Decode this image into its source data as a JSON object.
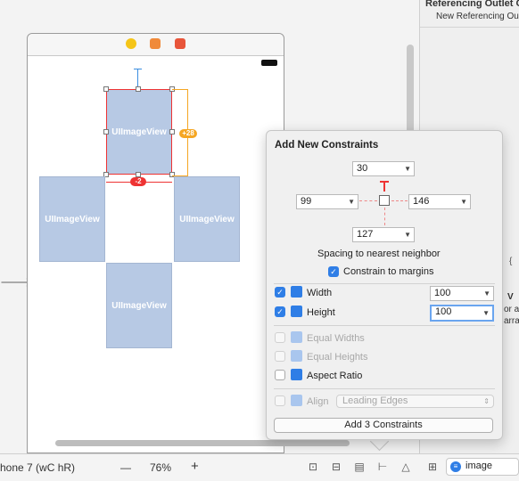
{
  "canvas": {
    "image_view_label": "UIImageView",
    "badge_spacing": "+28",
    "badge_red": "-2"
  },
  "inspector": {
    "section_title": "Referencing Outlet C",
    "item": "New Referencing Outlet",
    "fragments": [
      "V",
      "or a",
      "arra"
    ]
  },
  "popover": {
    "title": "Add New Constraints",
    "top": "30",
    "left": "99",
    "right": "146",
    "bottom": "127",
    "spacing_label": "Spacing to nearest neighbor",
    "constrain_margins_label": "Constrain to margins",
    "width_label": "Width",
    "width_value": "100",
    "height_label": "Height",
    "height_value": "100",
    "equal_widths_label": "Equal Widths",
    "equal_heights_label": "Equal Heights",
    "aspect_ratio_label": "Aspect Ratio",
    "align_label": "Align",
    "align_value": "Leading Edges",
    "add_button_label": "Add 3 Constraints"
  },
  "bottom_bar": {
    "device_label": "hone 7 (wC hR)",
    "zoom_out": "—",
    "zoom": "76%",
    "zoom_in": "+",
    "search_value": "image"
  },
  "colors": {
    "accent": "#2f7ee6",
    "image_view": "#b7c9e4",
    "constraint_orange": "#f5a623",
    "constraint_red": "#e33333"
  }
}
